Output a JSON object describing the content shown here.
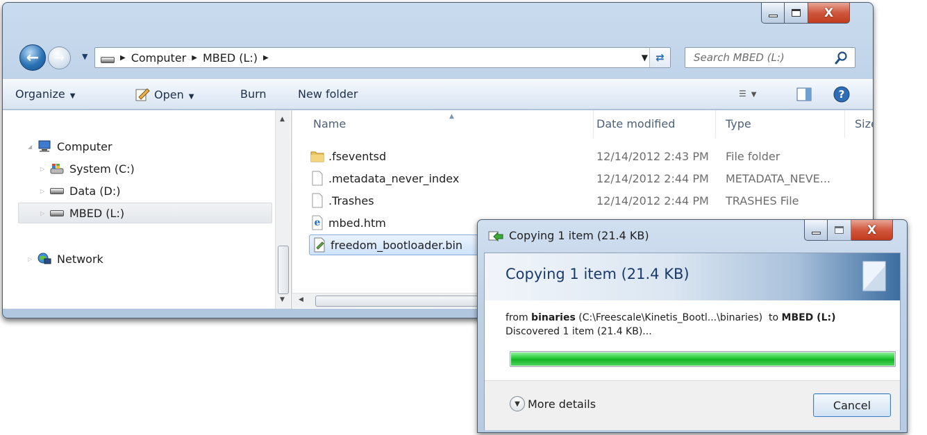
{
  "explorer": {
    "breadcrumb": [
      "Computer",
      "MBED (L:)"
    ],
    "search_placeholder": "Search MBED (L:)",
    "toolbar": {
      "organize": "Organize",
      "open": "Open",
      "burn": "Burn",
      "new_folder": "New folder"
    },
    "nav": [
      {
        "label": "Computer",
        "icon": "computer-icon"
      },
      {
        "label": "System (C:)",
        "icon": "system-drive-icon"
      },
      {
        "label": "Data (D:)",
        "icon": "drive-icon"
      },
      {
        "label": "MBED (L:)",
        "icon": "drive-icon",
        "selected": true
      },
      {
        "label": "Network",
        "icon": "network-icon"
      }
    ],
    "columns": [
      "Name",
      "Date modified",
      "Type",
      "Size"
    ],
    "files": [
      {
        "name": ".fseventsd",
        "date": "12/14/2012 2:43 PM",
        "type": "File folder",
        "icon": "folder-icon"
      },
      {
        "name": ".metadata_never_index",
        "date": "12/14/2012 2:44 PM",
        "type": "METADATA_NEVE...",
        "icon": "blank-file-icon"
      },
      {
        "name": ".Trashes",
        "date": "12/14/2012 2:44 PM",
        "type": "TRASHES File",
        "icon": "blank-file-icon"
      },
      {
        "name": "mbed.htm",
        "date": "",
        "type": "",
        "icon": "ie-icon"
      },
      {
        "name": "freedom_bootloader.bin",
        "date": "",
        "type": "",
        "icon": "bin-file-icon",
        "selected": true
      }
    ]
  },
  "copy_dialog": {
    "title": "Copying 1 item (21.4 KB)",
    "heading": "Copying 1 item (21.4 KB)",
    "from_prefix": "from",
    "from_name": "binaries",
    "from_path": "(C:\\Freescale\\Kinetis_Bootl...\\binaries)",
    "to_prefix": "to",
    "to_name": "MBED (L:)",
    "status": "Discovered 1 item (21.4 KB)...",
    "progress": 1.0,
    "more_details": "More details",
    "cancel": "Cancel"
  },
  "colors": {
    "progress_green": "#22c934",
    "accent_blue": "#2b73b5",
    "close_red": "#c23b1e"
  }
}
